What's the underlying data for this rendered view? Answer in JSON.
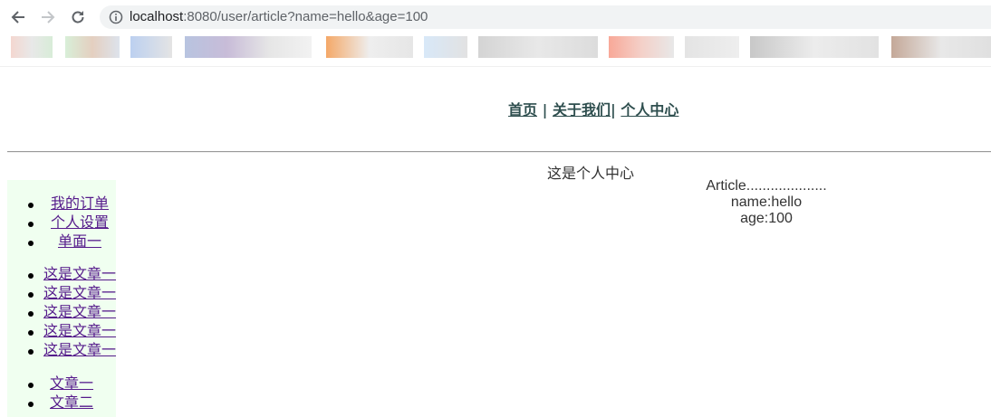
{
  "browser": {
    "url_host": "localhost",
    "url_rest": ":8080/user/article?name=hello&age=100",
    "info_icon": "info-circle-icon",
    "back_icon": "arrow-left-icon",
    "forward_icon": "arrow-right-icon",
    "reload_icon": "reload-icon"
  },
  "nav": {
    "home": "首页",
    "sep1": " | ",
    "about": "关于我们",
    "sep2": "| ",
    "profile": "个人中心"
  },
  "page": {
    "heading": "这是个人中心"
  },
  "article": {
    "title": "Article....................",
    "name_line": "name:hello",
    "age_line": "age:100"
  },
  "sidebar": {
    "group1": [
      "我的订单",
      "个人设置",
      "单面一"
    ],
    "group2": [
      "这是文章一",
      "这是文章一",
      "这是文章一",
      "这是文章一",
      "这是文章一"
    ],
    "group3": [
      "文章一",
      "文章二"
    ]
  },
  "colors": {
    "sidebar_bg": "#f0fff0",
    "nav_link": "#2f4f4f",
    "visited_link": "#551a8b"
  }
}
